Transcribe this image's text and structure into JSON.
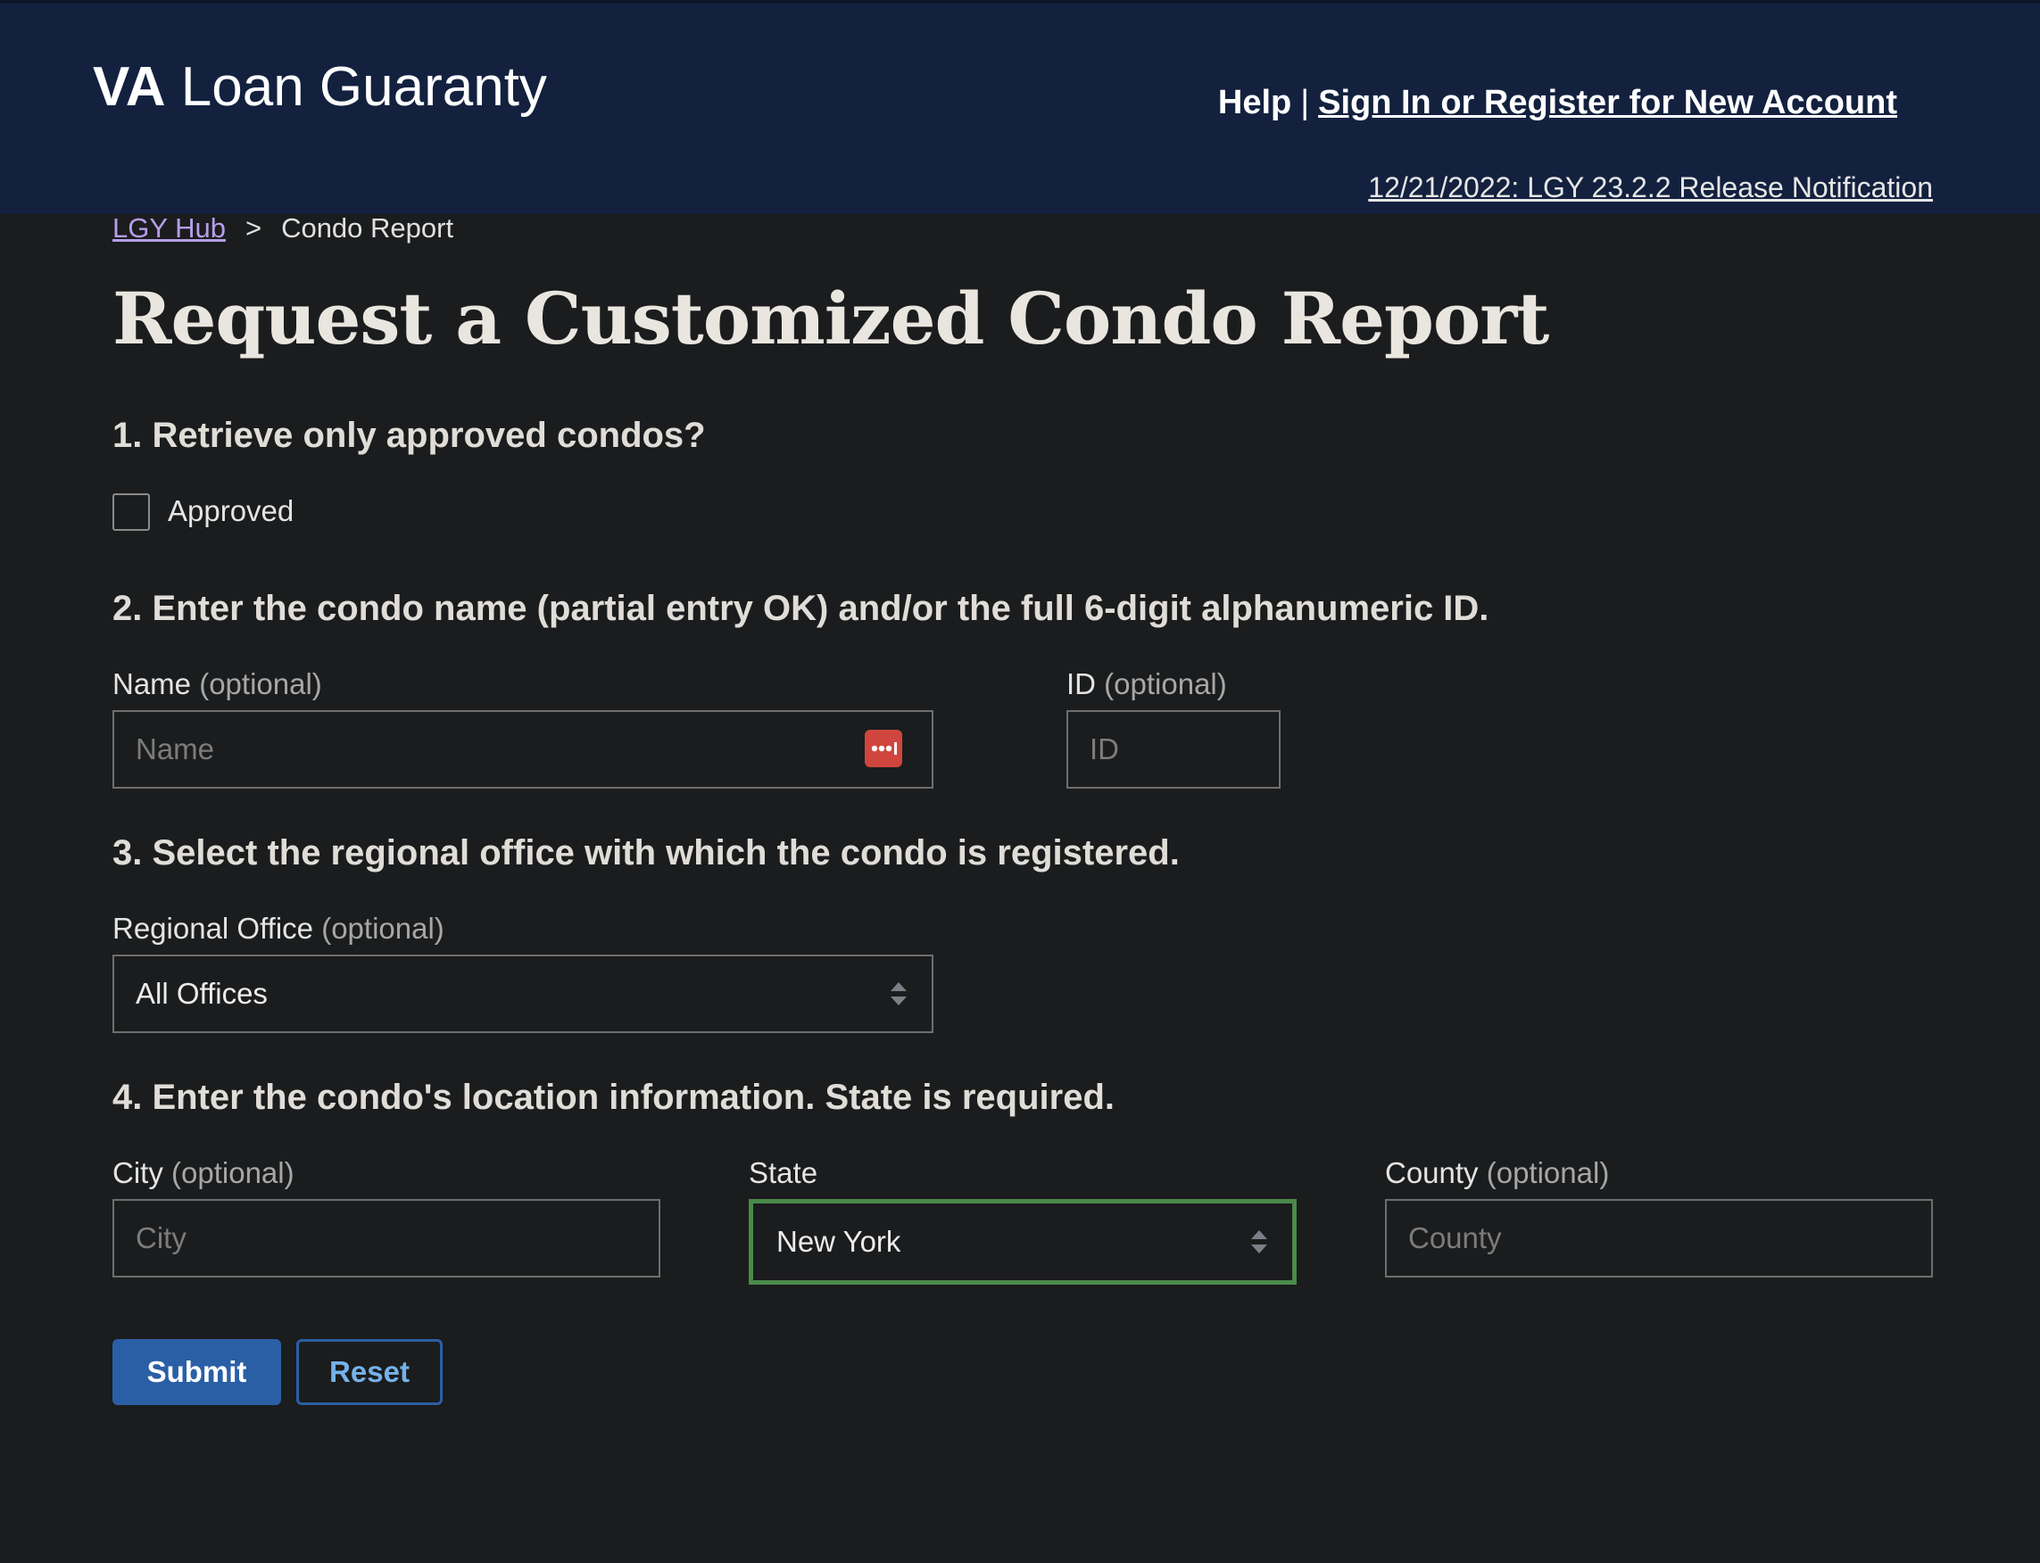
{
  "header": {
    "logo_bold": "VA",
    "logo_rest": " Loan Guaranty",
    "help_label": "Help",
    "separator": "|",
    "signin_label": "Sign In or Register for New Account",
    "release_notice": "12/21/2022: LGY 23.2.2 Release Notification"
  },
  "breadcrumb": {
    "home": "LGY Hub",
    "separator": ">",
    "current": "Condo Report"
  },
  "page_title": "Request a Customized Condo Report",
  "section1": {
    "heading": "1. Retrieve only approved condos?",
    "checkbox_label": "Approved",
    "checked": false
  },
  "section2": {
    "heading": "2. Enter the condo name (partial entry OK) and/or the full 6-digit alphanumeric ID.",
    "name_label": "Name",
    "name_optional": "(optional)",
    "name_placeholder": "Name",
    "name_value": "",
    "id_label": "ID",
    "id_optional": "(optional)",
    "id_placeholder": "ID",
    "id_value": ""
  },
  "section3": {
    "heading": "3. Select the regional office with which the condo is registered.",
    "office_label": "Regional Office",
    "office_optional": "(optional)",
    "office_selected": "All Offices"
  },
  "section4": {
    "heading": "4. Enter the condo's location information. State is required.",
    "city_label": "City",
    "city_optional": "(optional)",
    "city_placeholder": "City",
    "state_label": "State",
    "state_selected": "New York",
    "county_label": "County",
    "county_optional": "(optional)",
    "county_placeholder": "County"
  },
  "buttons": {
    "submit": "Submit",
    "reset": "Reset"
  },
  "colors": {
    "header_bg": "#13213f",
    "page_bg": "#1b1c1d",
    "primary_button": "#2a5fa6",
    "focus_border": "#4a8a4a",
    "link_visited": "#b59ee8",
    "password_manager_icon": "#d0463e"
  }
}
